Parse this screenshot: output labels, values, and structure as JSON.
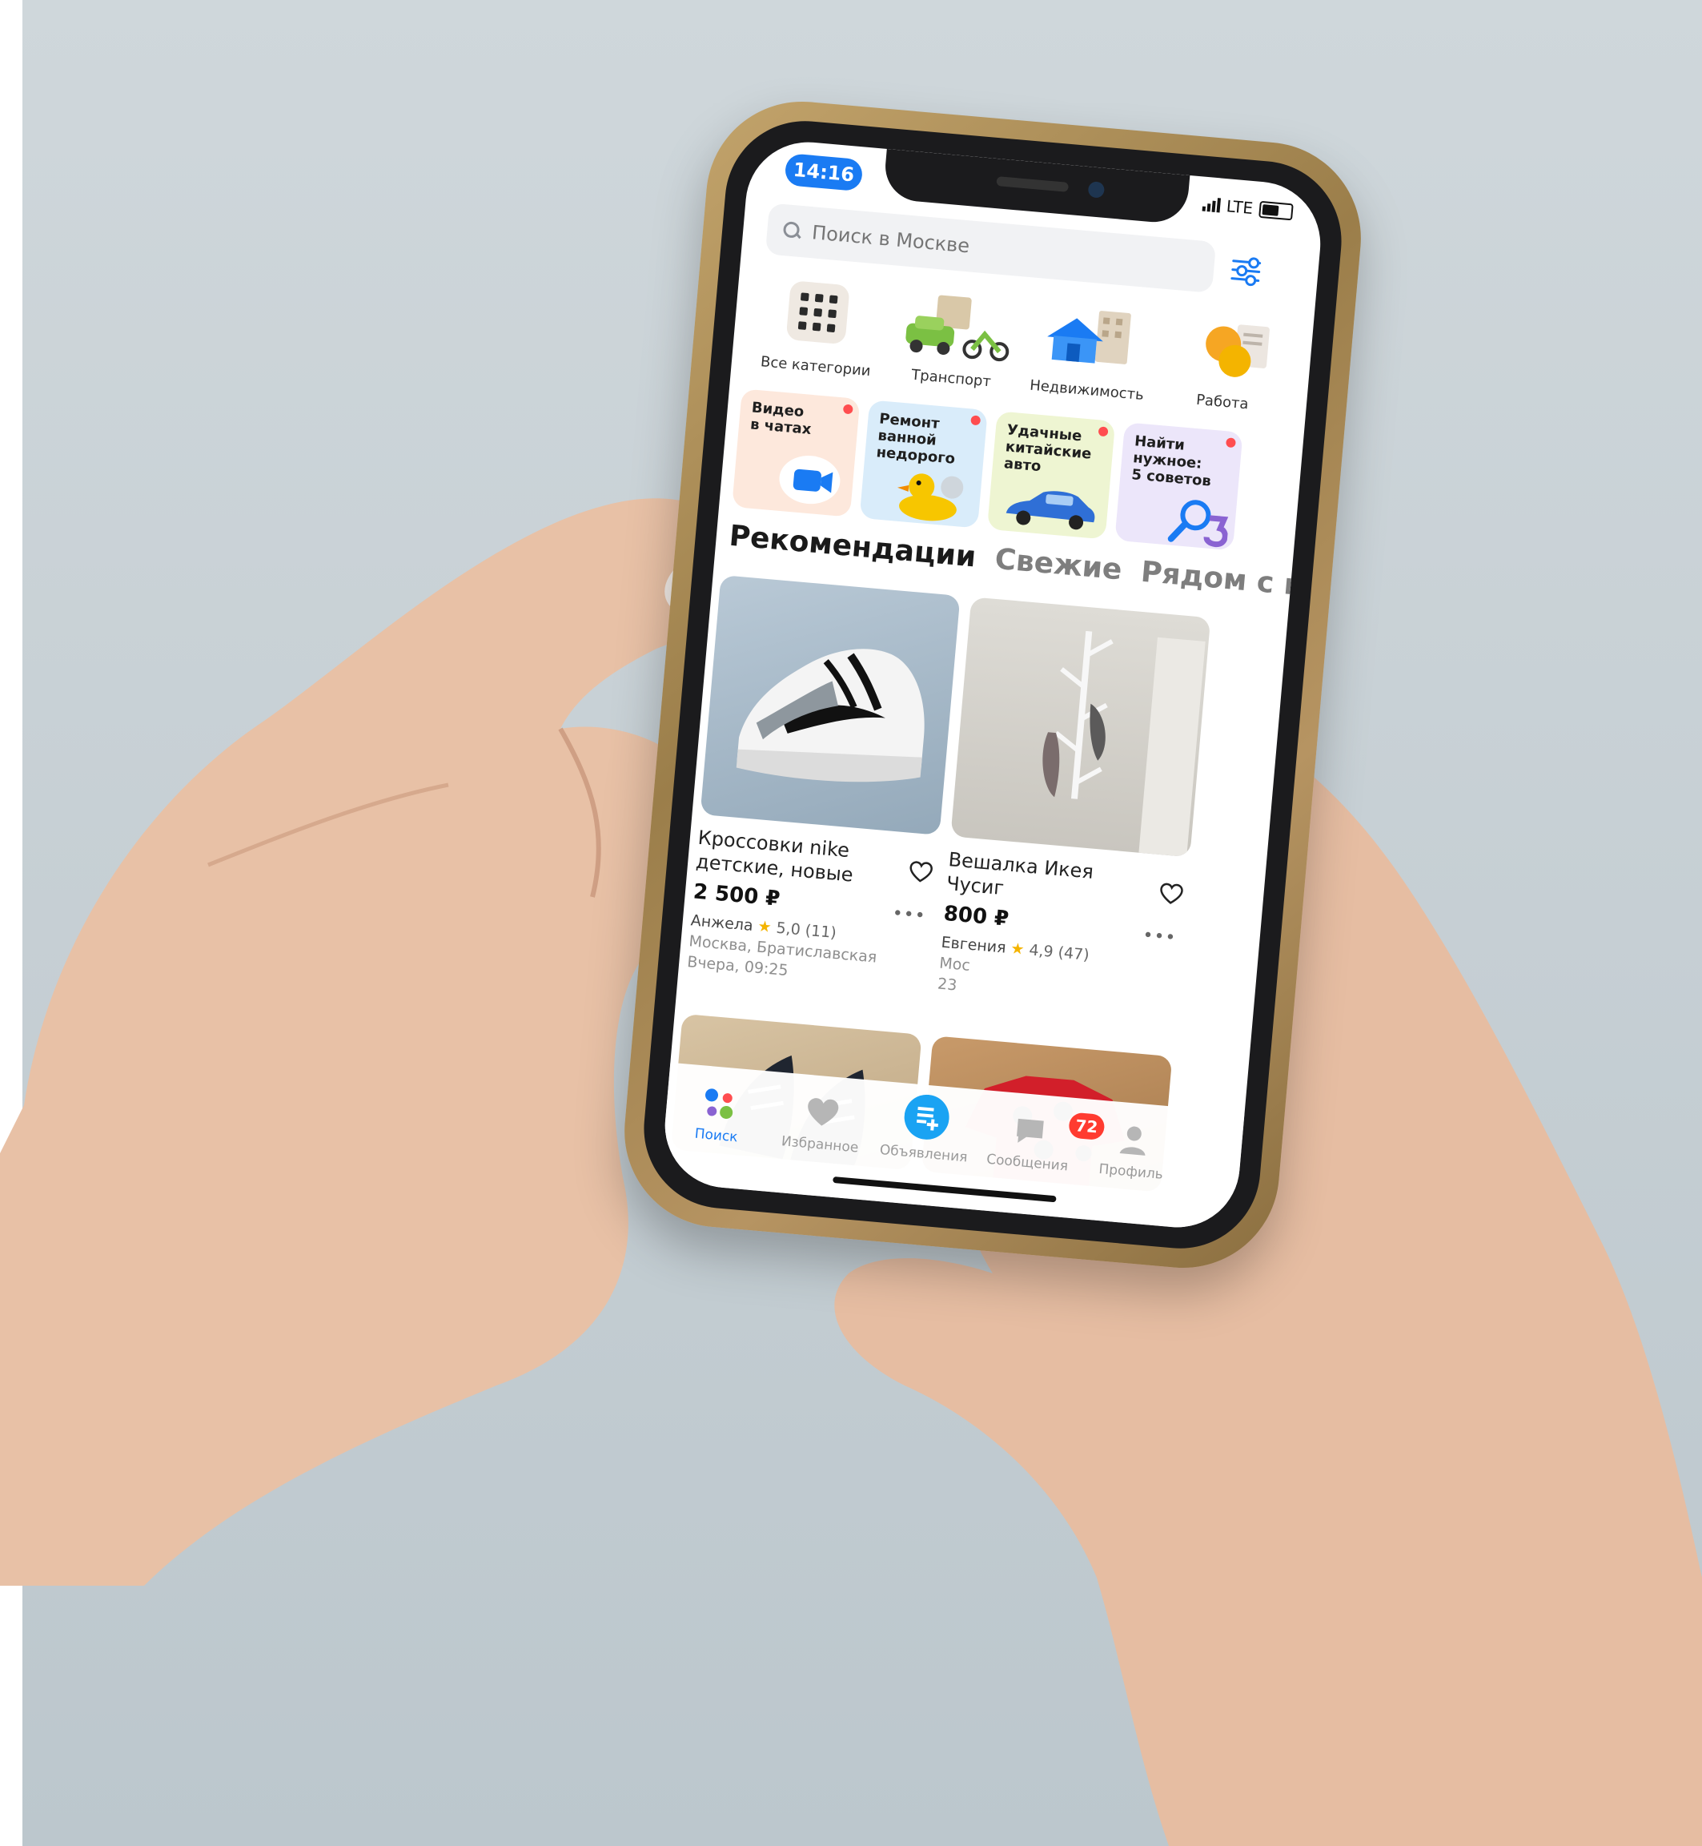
{
  "status_bar": {
    "time": "14:16",
    "network": "LTE"
  },
  "search": {
    "placeholder": "Поиск в Москве"
  },
  "categories": [
    {
      "label": "Все категории"
    },
    {
      "label": "Транспорт"
    },
    {
      "label": "Недвижимость"
    },
    {
      "label": "Работа"
    }
  ],
  "stories": [
    {
      "text": "Видео\nв чатах",
      "bg": "#fde8dc"
    },
    {
      "text": "Ремонт\nванной\nнедорого",
      "bg": "#d9ecfa"
    },
    {
      "text": "Удачные\nкитайские\nавто",
      "bg": "#eef5d2"
    },
    {
      "text": "Найти\nнужное:\n5 советов",
      "bg": "#ece6fa"
    }
  ],
  "tabs": [
    {
      "label": "Рекомендации",
      "active": true
    },
    {
      "label": "Свежие",
      "active": false
    },
    {
      "label": "Рядом с ва",
      "active": false
    }
  ],
  "listings": [
    {
      "title": "Кроссовки nike\nдетские, новые",
      "price": "2 500 ₽",
      "seller": "Анжела",
      "rating": "5,0 (11)",
      "location": "Москва, Братиславская",
      "date": "Вчера, 09:25"
    },
    {
      "title": "Вешалка Икея\nЧусиг",
      "price": "800 ₽",
      "seller": "Евгения",
      "rating": "4,9 (47)",
      "location": "Мос",
      "date": "23"
    }
  ],
  "bottom_nav": [
    {
      "label": "Поиск",
      "active": true
    },
    {
      "label": "Избранное",
      "active": false
    },
    {
      "label": "Объявления",
      "active": false
    },
    {
      "label": "Сообщения",
      "active": false,
      "badge": "72"
    },
    {
      "label": "Профиль",
      "active": false
    }
  ],
  "colors": {
    "accent": "#1a7bf3",
    "badge": "#ff3b30",
    "star": "#f4b400"
  }
}
